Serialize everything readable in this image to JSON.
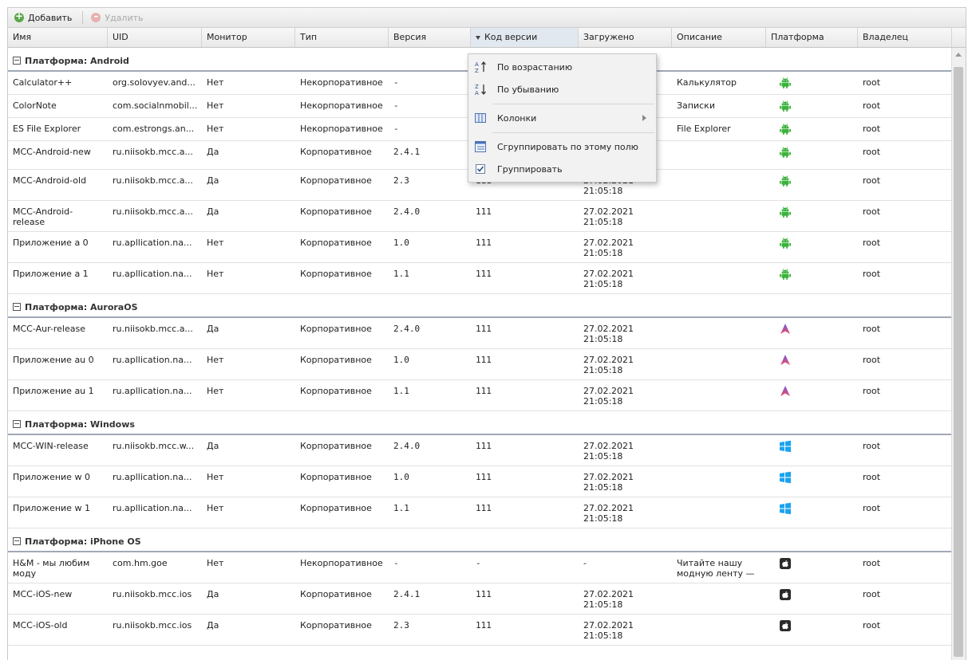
{
  "toolbar": {
    "add_label": "Добавить",
    "delete_label": "Удалить"
  },
  "columns": [
    "Имя",
    "UID",
    "Монитор",
    "Тип",
    "Версия",
    "Код версии",
    "Загружено",
    "Описание",
    "Платформа",
    "Владелец"
  ],
  "groups": [
    {
      "title": "Платформа: Android",
      "platform_icon": "android-icon",
      "rows": [
        [
          "Calculator++",
          "org.solovyev.and...",
          "Нет",
          "Некорпоративное",
          "-",
          "",
          "",
          "Калькулятор",
          "",
          "root"
        ],
        [
          "ColorNote",
          "com.socialnmobil...",
          "Нет",
          "Некорпоративное",
          "-",
          "",
          "",
          "Записки",
          "",
          "root"
        ],
        [
          "ES File Explorer",
          "com.estrongs.an...",
          "Нет",
          "Некорпоративное",
          "-",
          "",
          "",
          "File Explorer",
          "",
          "root"
        ],
        [
          "MCC-Android-new",
          "ru.niisokb.mcc.a...",
          "Да",
          "Корпоративное",
          "2.4.1",
          "",
          "",
          "",
          "",
          "root"
        ],
        [
          "MCC-Android-old",
          "ru.niisokb.mcc.a...",
          "Да",
          "Корпоративное",
          "2.3",
          "111",
          "27.02.2021 21:05:18",
          "",
          "",
          "root"
        ],
        [
          "MCC-Android-release",
          "ru.niisokb.mcc.a...",
          "Да",
          "Корпоративное",
          "2.4.0",
          "111",
          "27.02.2021 21:05:18",
          "",
          "",
          "root"
        ],
        [
          "Приложение a 0",
          "ru.apllication.na...",
          "Нет",
          "Корпоративное",
          "1.0",
          "111",
          "27.02.2021 21:05:18",
          "",
          "",
          "root"
        ],
        [
          "Приложение a 1",
          "ru.apllication.na...",
          "Нет",
          "Корпоративное",
          "1.1",
          "111",
          "27.02.2021 21:05:18",
          "",
          "",
          "root"
        ]
      ]
    },
    {
      "title": "Платформа: AuroraOS",
      "platform_icon": "aurora-icon",
      "rows": [
        [
          "MCC-Aur-release",
          "ru.niisokb.mcc.a...",
          "Да",
          "Корпоративное",
          "2.4.0",
          "111",
          "27.02.2021 21:05:18",
          "",
          "",
          "root"
        ],
        [
          "Приложение au 0",
          "ru.apllication.na...",
          "Нет",
          "Корпоративное",
          "1.0",
          "111",
          "27.02.2021 21:05:18",
          "",
          "",
          "root"
        ],
        [
          "Приложение au 1",
          "ru.apllication.na...",
          "Нет",
          "Корпоративное",
          "1.1",
          "111",
          "27.02.2021 21:05:18",
          "",
          "",
          "root"
        ]
      ]
    },
    {
      "title": "Платформа: Windows",
      "platform_icon": "windows-icon",
      "rows": [
        [
          "MCC-WIN-release",
          "ru.niisokb.mcc.w...",
          "Да",
          "Корпоративное",
          "2.4.0",
          "111",
          "27.02.2021 21:05:18",
          "",
          "",
          "root"
        ],
        [
          "Приложение w 0",
          "ru.apllication.na...",
          "Нет",
          "Корпоративное",
          "1.0",
          "111",
          "27.02.2021 21:05:18",
          "",
          "",
          "root"
        ],
        [
          "Приложение w 1",
          "ru.apllication.na...",
          "Нет",
          "Корпоративное",
          "1.1",
          "111",
          "27.02.2021 21:05:18",
          "",
          "",
          "root"
        ]
      ]
    },
    {
      "title": "Платформа: iPhone OS",
      "platform_icon": "apple-icon",
      "rows": [
        [
          "H&M - мы любим моду",
          "com.hm.goe",
          "Нет",
          "Некорпоративное",
          "-",
          "-",
          "-",
          "Читайте нашу модную ленту —",
          "",
          "root"
        ],
        [
          "MCC-iOS-new",
          "ru.niisokb.mcc.ios",
          "Да",
          "Корпоративное",
          "2.4.1",
          "111",
          "27.02.2021 21:05:18",
          "",
          "",
          "root"
        ],
        [
          "MCC-iOS-old",
          "ru.niisokb.mcc.ios",
          "Да",
          "Корпоративное",
          "2.3",
          "111",
          "27.02.2021 21:05:18",
          "",
          "",
          "root"
        ]
      ]
    }
  ],
  "menu": {
    "sort_asc": "По возрастанию",
    "sort_desc": "По убыванию",
    "columns": "Колонки",
    "group_by_field": "Сгруппировать по этому полю",
    "group": "Группировать",
    "group_checked": true
  },
  "colors": {
    "android": "#3ab33a",
    "aurora_top": "#6f5ad8",
    "aurora_bottom": "#ef4d6a",
    "windows": "#1aa3ef",
    "apple": "#2b2b2b"
  }
}
